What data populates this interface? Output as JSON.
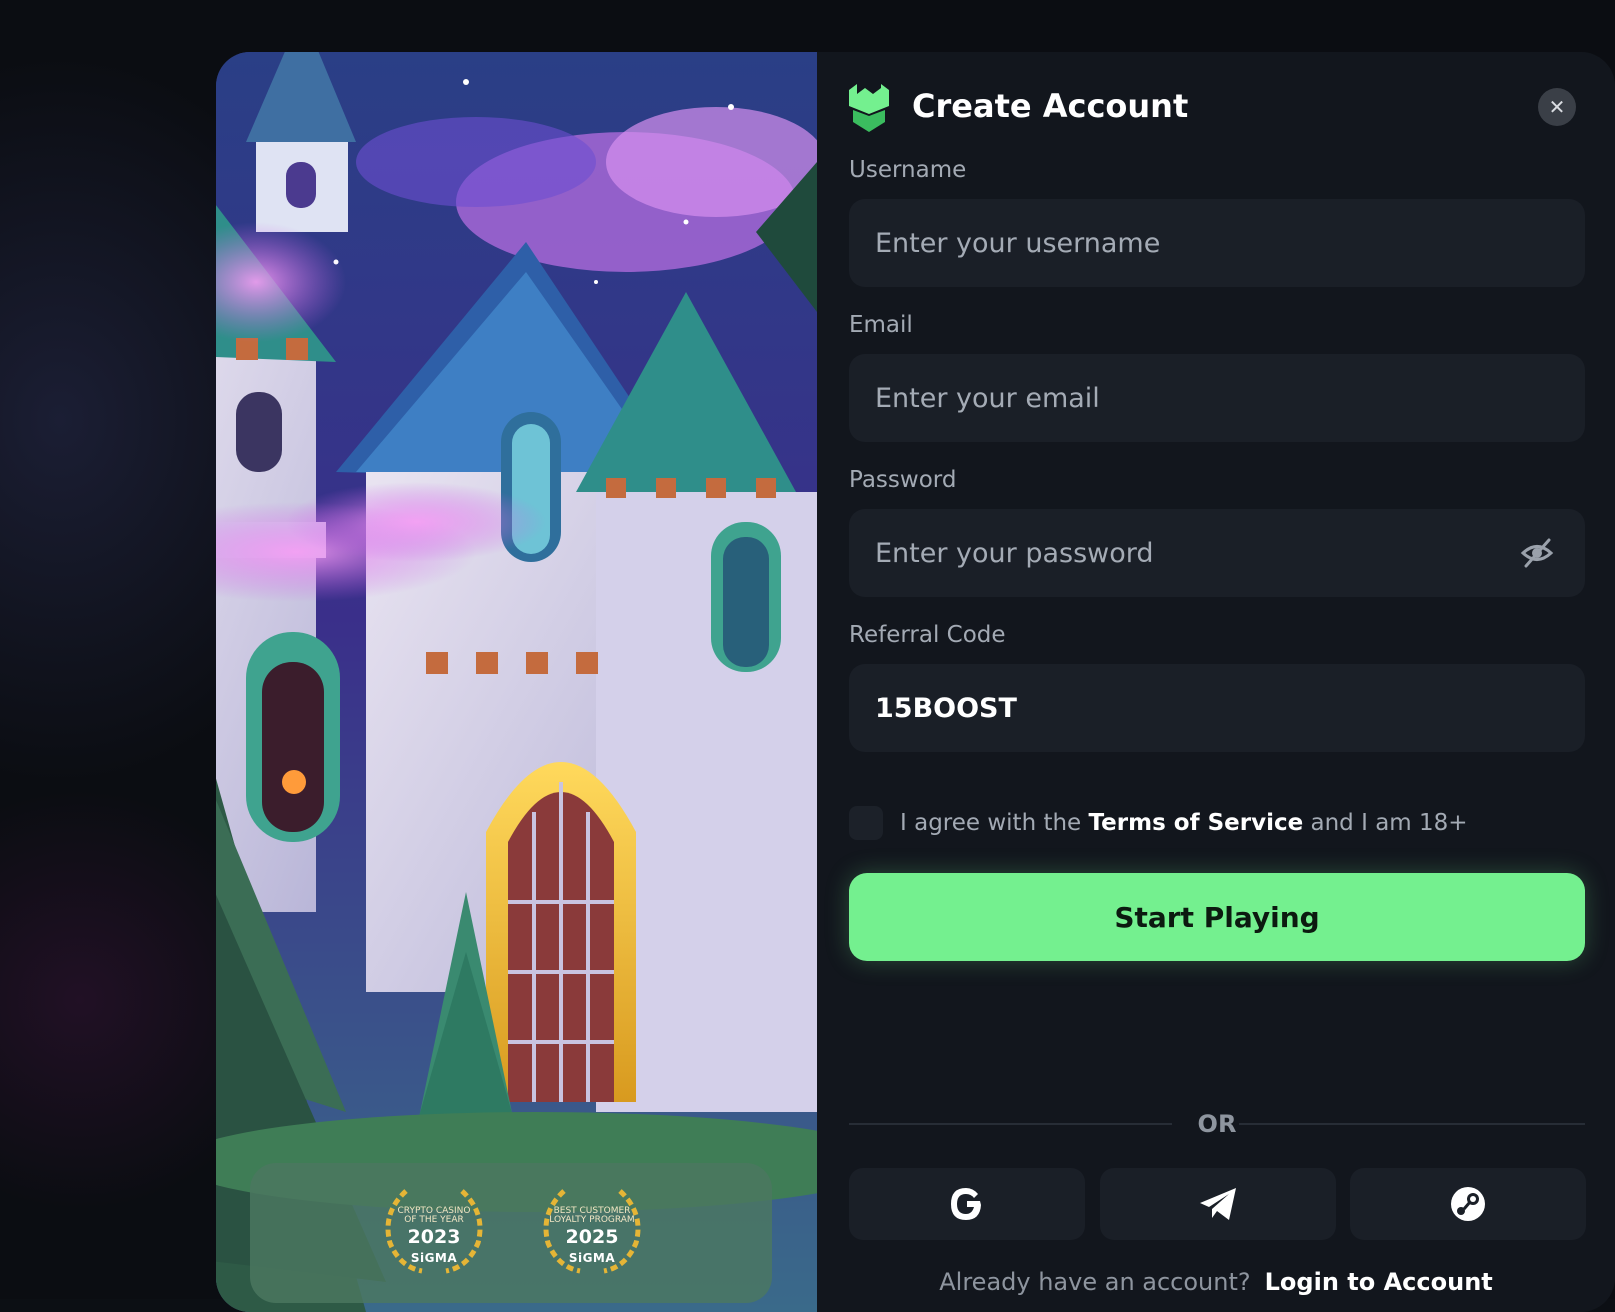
{
  "modal": {
    "title": "Create Account",
    "close_icon": "close-icon"
  },
  "form": {
    "username": {
      "label": "Username",
      "placeholder": "Enter your username",
      "value": ""
    },
    "email": {
      "label": "Email",
      "placeholder": "Enter your email",
      "value": ""
    },
    "password": {
      "label": "Password",
      "placeholder": "Enter your password",
      "value": "",
      "toggle_icon": "eye-off-icon"
    },
    "referral": {
      "label": "Referral Code",
      "value": "15BOOST"
    },
    "agree": {
      "prefix": "I agree with the",
      "link": "Terms of Service",
      "suffix": "and I am 18+",
      "checked": false
    },
    "submit_label": "Start Playing"
  },
  "divider": {
    "label": "OR"
  },
  "social": [
    {
      "name": "google",
      "icon": "google-icon"
    },
    {
      "name": "telegram",
      "icon": "telegram-icon"
    },
    {
      "name": "steam",
      "icon": "steam-icon"
    }
  ],
  "footer": {
    "question": "Already have an account?",
    "login_link": "Login to Account"
  },
  "awards": [
    {
      "line1": "CRYPTO CASINO",
      "line2": "OF THE YEAR",
      "year": "2023",
      "org": "SiGMA"
    },
    {
      "line1": "BEST CUSTOMER",
      "line2": "LOYALTY PROGRAM",
      "year": "2025",
      "org": "SiGMA"
    }
  ],
  "colors": {
    "accent": "#74f08f",
    "background": "#12161d",
    "field": "#1a1f27",
    "muted_text": "#a3aab4"
  }
}
